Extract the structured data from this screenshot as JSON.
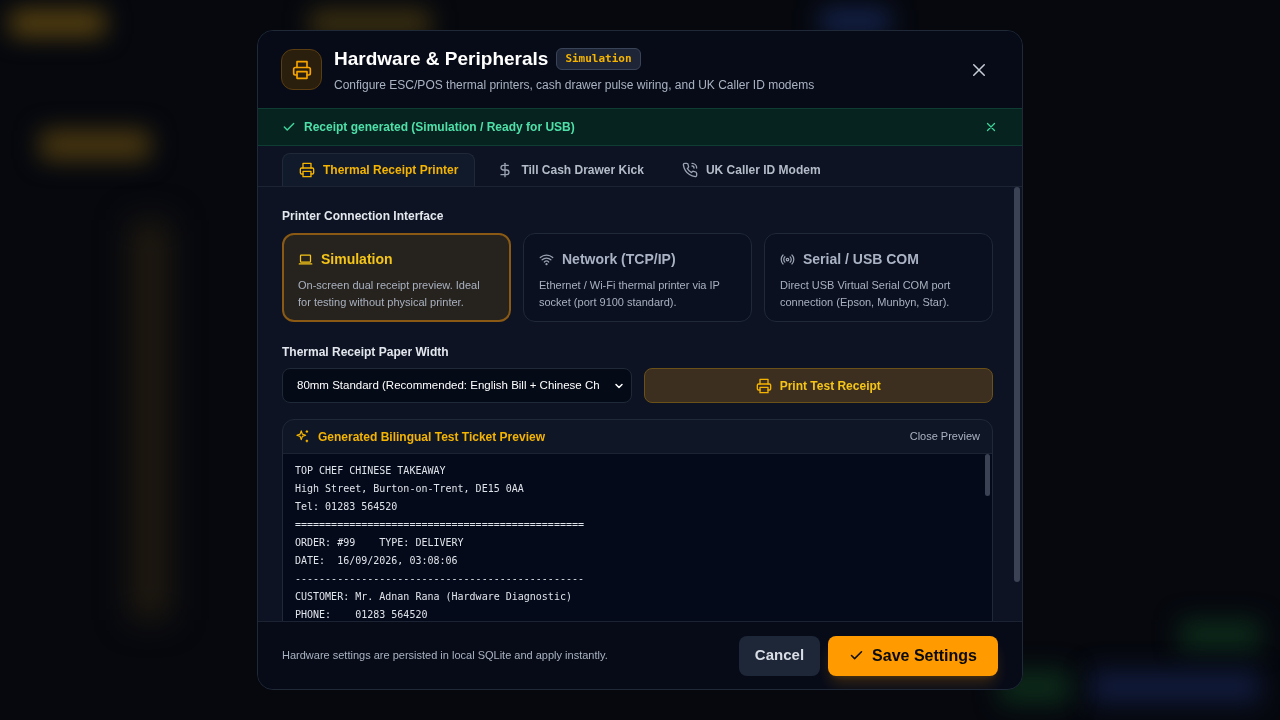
{
  "dialog": {
    "title": "Hardware & Peripherals",
    "badge": "Simulation",
    "subtitle": "Configure ESC/POS thermal printers, cash drawer pulse wiring, and UK Caller ID modems"
  },
  "banner": {
    "message": "Receipt generated (Simulation / Ready for USB)"
  },
  "tabs": [
    {
      "label": "Thermal Receipt Printer",
      "kind": "printer",
      "selected": true
    },
    {
      "label": "Till Cash Drawer Kick",
      "kind": "cash",
      "selected": false
    },
    {
      "label": "UK Caller ID Modem",
      "kind": "phone",
      "selected": false
    }
  ],
  "interface": {
    "label": "Printer Connection Interface",
    "options": [
      {
        "title": "Simulation",
        "description": "On-screen dual receipt preview. Ideal for testing without physical printer.",
        "kind": "laptop",
        "selected": true
      },
      {
        "title": "Network (TCP/IP)",
        "description": "Ethernet / Wi-Fi thermal printer via IP socket (port 9100 standard).",
        "kind": "wifi",
        "selected": false
      },
      {
        "title": "Serial / USB COM",
        "description": "Direct USB Virtual Serial COM port connection (Epson, Munbyn, Star).",
        "kind": "serial",
        "selected": false
      }
    ]
  },
  "paper_width": {
    "label": "Thermal Receipt Paper Width",
    "value": "80mm Standard (Recommended: English Bill + Chinese Ch"
  },
  "print_button": "Print Test Receipt",
  "preview": {
    "title": "Generated Bilingual Test Ticket Preview",
    "close_label": "Close Preview",
    "lines": [
      "TOP CHEF CHINESE TAKEAWAY",
      "High Street, Burton-on-Trent, DE15 0AA",
      "Tel: 01283 564520",
      "================================================",
      "ORDER: #99    TYPE: DELIVERY",
      "DATE:  16/09/2026, 03:08:06",
      "------------------------------------------------",
      "CUSTOMER: Mr. Adnan Rana (Hardware Diagnostic)",
      "PHONE:    01283 564520"
    ]
  },
  "footer": {
    "note": "Hardware settings are persisted in local SQLite and apply instantly.",
    "cancel": "Cancel",
    "save": "Save Settings"
  }
}
